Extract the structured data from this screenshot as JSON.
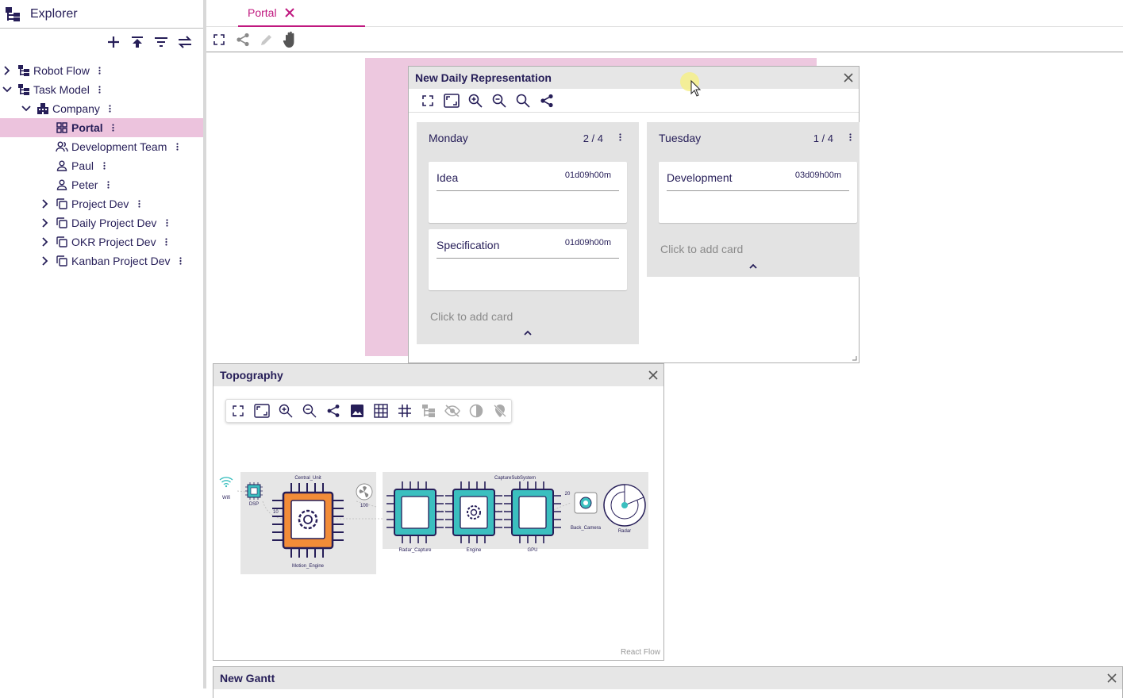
{
  "explorer": {
    "title": "Explorer",
    "actions": [
      "add-icon",
      "collapse-all-icon",
      "filter-icon",
      "swap-icon"
    ],
    "tree": [
      {
        "label": "Robot Flow",
        "level": 0,
        "expanded": false,
        "icon": "hierarchy-icon"
      },
      {
        "label": "Task Model",
        "level": 0,
        "expanded": true,
        "icon": "hierarchy-icon"
      },
      {
        "label": "Company",
        "level": 1,
        "expanded": true,
        "icon": "company-icon"
      },
      {
        "label": "Portal",
        "level": 2,
        "selected": true,
        "icon": "dashboard-icon"
      },
      {
        "label": "Development Team",
        "level": 2,
        "icon": "team-icon"
      },
      {
        "label": "Paul",
        "level": 2,
        "icon": "person-icon"
      },
      {
        "label": "Peter",
        "level": 2,
        "icon": "person-icon"
      },
      {
        "label": "Project Dev",
        "level": 2,
        "expanded": false,
        "icon": "project-icon"
      },
      {
        "label": "Daily Project Dev",
        "level": 2,
        "expanded": false,
        "icon": "project-icon"
      },
      {
        "label": "OKR Project Dev",
        "level": 2,
        "expanded": false,
        "icon": "project-icon"
      },
      {
        "label": "Kanban Project Dev",
        "level": 2,
        "expanded": false,
        "icon": "project-icon"
      }
    ]
  },
  "tabs": [
    {
      "label": "Portal",
      "active": true
    }
  ],
  "colors": {
    "accent": "#c0187f",
    "text": "#261e58",
    "selection": "#ecc3dd",
    "node_teal": "#3bbfbf",
    "node_orange": "#f28c38"
  },
  "daily": {
    "title": "New Daily Representation",
    "lanes": [
      {
        "name": "Monday",
        "count": "2 / 4",
        "cards": [
          {
            "title": "Idea",
            "time": "01d09h00m"
          },
          {
            "title": "Specification",
            "time": "01d09h00m"
          }
        ],
        "add_label": "Click to add card"
      },
      {
        "name": "Tuesday",
        "count": "1 / 4",
        "cards": [
          {
            "title": "Development",
            "time": "03d09h00m"
          }
        ],
        "add_label": "Click to add card"
      }
    ]
  },
  "topography": {
    "title": "Topography",
    "attribution": "React Flow",
    "nodes": {
      "wifi": "Wifi",
      "dsp": "DSP",
      "central_unit": "Central_Unit",
      "motion_engine": "Motion_Engine",
      "capture_subsystem": "CaptureSubSystem",
      "radar_capture": "Radar_Capture",
      "engine": "Engine",
      "gpu": "GPU",
      "back_camera": "Back_Camera",
      "radar": "Radar"
    },
    "edge_labels": {
      "fan_value": "100",
      "capture_value": "20",
      "dsp_value": "10"
    }
  },
  "gantt": {
    "title": "New Gantt"
  }
}
